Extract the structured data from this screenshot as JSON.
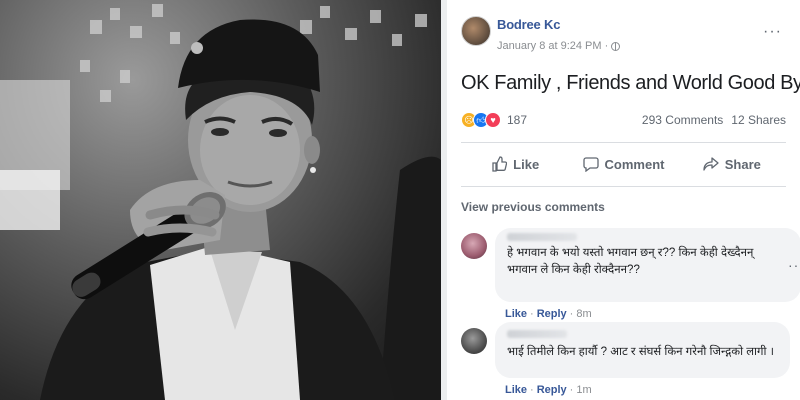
{
  "post": {
    "author": "Bodree Kc",
    "timestamp": "January 8 at 9:24 PM",
    "meta_separator": "·",
    "privacy_icon": "globe-icon",
    "text": "OK Family , Friends and World Good Byee",
    "reactions": {
      "icons": [
        "sad-reaction-icon",
        "like-reaction-icon",
        "love-reaction-icon"
      ],
      "count": "187"
    },
    "comments_count": "293 Comments",
    "shares_count": "12 Shares"
  },
  "actions": {
    "like": "Like",
    "comment": "Comment",
    "share": "Share"
  },
  "view_previous": "View previous comments",
  "comments": [
    {
      "text_line1": "हे भगवान के भयो यस्तो भगवान छन् र?? किन केही देख्दैनन्",
      "text_line2": "भगवान ले किन केही रोक्दैनन??",
      "like": "Like",
      "reply": "Reply",
      "time": "8m"
    },
    {
      "text_line1": "भाई तिमीले किन हार्यौ ? आट र संघर्स किन गरेनौ जिन्द्गको लागी ।",
      "like": "Like",
      "reply": "Reply",
      "time": "1m"
    }
  ],
  "colors": {
    "link": "#385898",
    "secondary_text": "#606770",
    "bubble": "#f2f3f5"
  }
}
